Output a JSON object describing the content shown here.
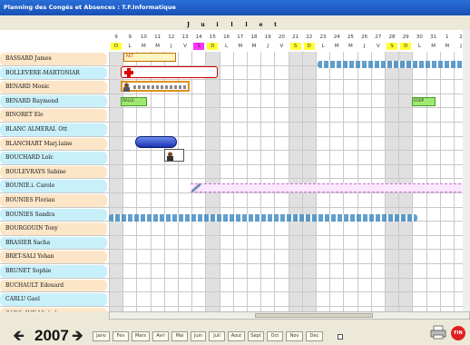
{
  "window": {
    "title": "Planning des Congés et Absences : T.F.Informatique"
  },
  "month_header": [
    "J",
    "u",
    "i",
    "l",
    "l",
    "e",
    "t"
  ],
  "days": [
    {
      "n": "9",
      "l": "D",
      "t": "we"
    },
    {
      "n": "9",
      "l": "L",
      "t": ""
    },
    {
      "n": "10",
      "l": "M",
      "t": ""
    },
    {
      "n": "11",
      "l": "M",
      "t": ""
    },
    {
      "n": "12",
      "l": "J",
      "t": ""
    },
    {
      "n": "13",
      "l": "V",
      "t": ""
    },
    {
      "n": "14",
      "l": "S",
      "t": "hl"
    },
    {
      "n": "15",
      "l": "D",
      "t": "we"
    },
    {
      "n": "16",
      "l": "L",
      "t": ""
    },
    {
      "n": "17",
      "l": "M",
      "t": ""
    },
    {
      "n": "18",
      "l": "M",
      "t": ""
    },
    {
      "n": "19",
      "l": "J",
      "t": ""
    },
    {
      "n": "20",
      "l": "V",
      "t": ""
    },
    {
      "n": "21",
      "l": "S",
      "t": "we"
    },
    {
      "n": "22",
      "l": "D",
      "t": "we"
    },
    {
      "n": "23",
      "l": "L",
      "t": ""
    },
    {
      "n": "24",
      "l": "M",
      "t": ""
    },
    {
      "n": "25",
      "l": "M",
      "t": ""
    },
    {
      "n": "26",
      "l": "J",
      "t": ""
    },
    {
      "n": "27",
      "l": "V",
      "t": ""
    },
    {
      "n": "28",
      "l": "S",
      "t": "we"
    },
    {
      "n": "29",
      "l": "D",
      "t": "we"
    },
    {
      "n": "30",
      "l": "L",
      "t": ""
    },
    {
      "n": "31",
      "l": "M",
      "t": ""
    },
    {
      "n": "1",
      "l": "M",
      "t": ""
    },
    {
      "n": "2",
      "l": "J",
      "t": ""
    }
  ],
  "employees": [
    "BASSARD James",
    "BOLLEVERE-MARTONIAR",
    "BENARD Monic",
    "BENARD Raymond",
    "BINORET Elo",
    "BLANC ALMERAI. Ott",
    "BLANCHART Marj.laine",
    "BOUCHARD Loïc",
    "BOULEVRAYS Sabine",
    "BOUNIE.i. Carole",
    "BOUNIES Florian",
    "BOUNIES Sandra",
    "BOURGOUIN Tony",
    "BRASIER Sacha",
    "BRET-SALI Yohan",
    "BRUNET Sophie",
    "BUCHAULT Edouard",
    "CARLU Gael",
    "CARO..INE Michel"
  ],
  "bars": {
    "ret_label": "RET",
    "dalle_label": "DALLE",
    "eodp_label": "EODP"
  },
  "footer": {
    "year": "2007",
    "months": [
      "Janv",
      "Fev",
      "Mars",
      "Avri",
      "Mai",
      "Juin",
      "Juil",
      "Aout",
      "Sept",
      "Oct",
      "Nov",
      "Dec"
    ],
    "fin_label": "FIN"
  }
}
